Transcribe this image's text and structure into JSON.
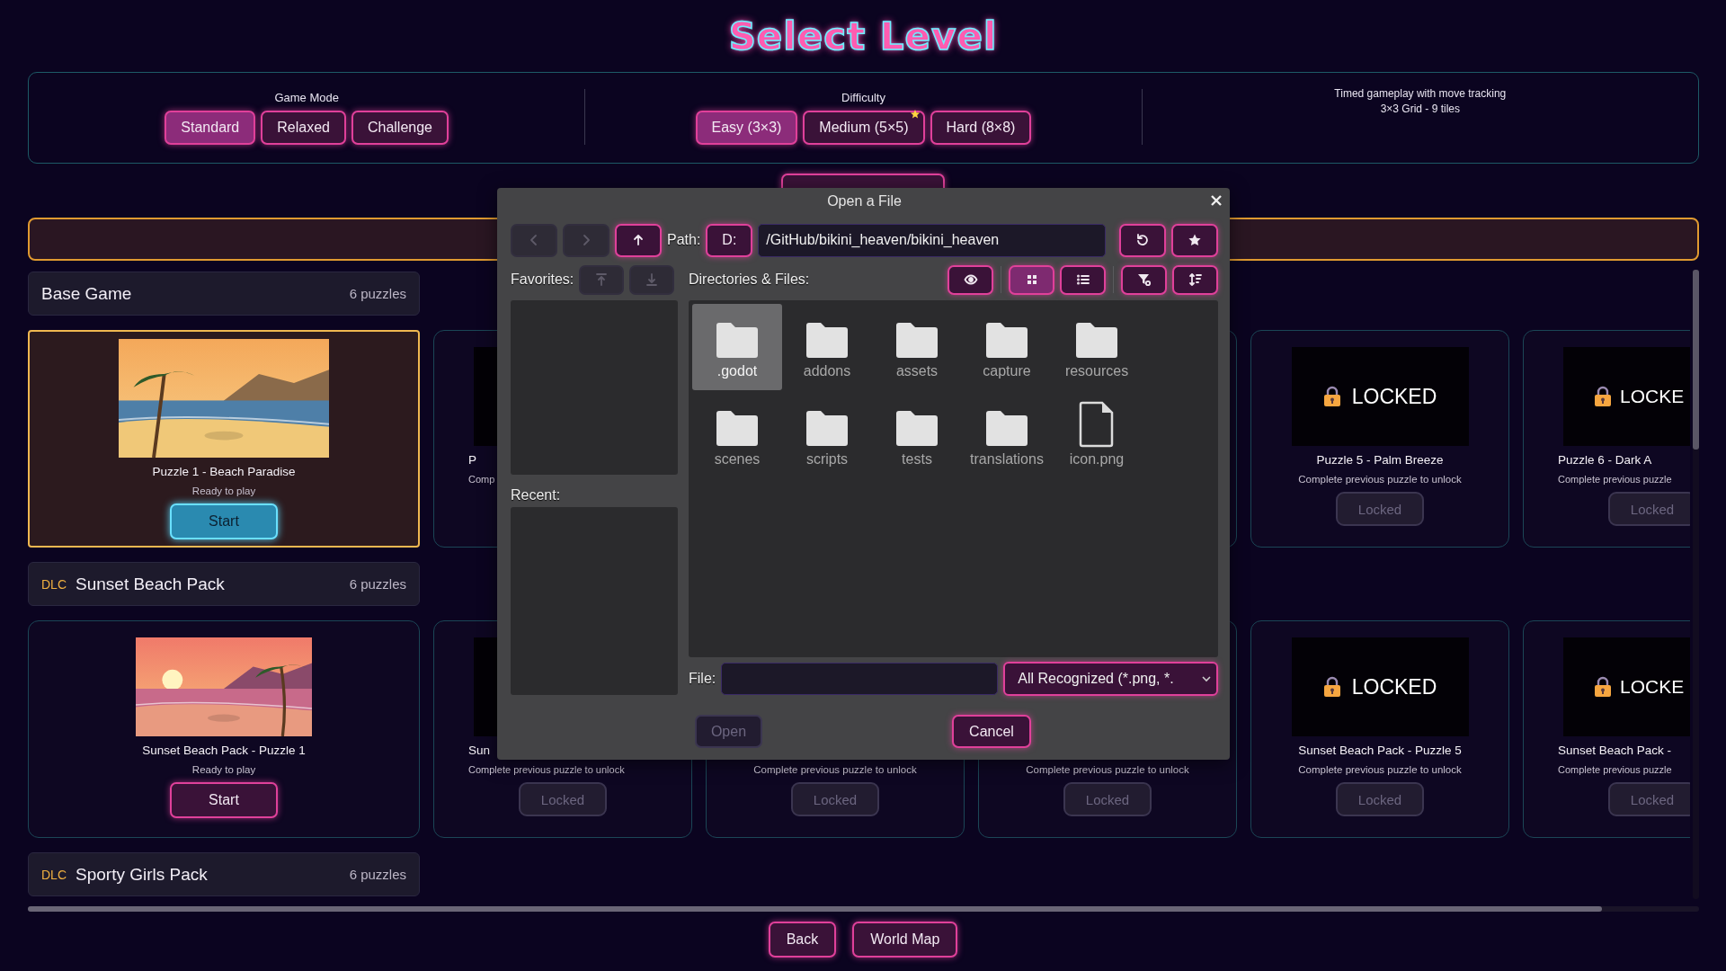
{
  "title": "Select Level",
  "game_mode": {
    "label": "Game Mode",
    "options": [
      {
        "label": "Standard",
        "selected": true
      },
      {
        "label": "Relaxed",
        "selected": false
      },
      {
        "label": "Challenge",
        "selected": false
      }
    ]
  },
  "difficulty": {
    "label": "Difficulty",
    "options": [
      {
        "label": "Easy (3×3)",
        "selected": true,
        "starred": false
      },
      {
        "label": "Medium (5×5)",
        "selected": false,
        "starred": true
      },
      {
        "label": "Hard (8×8)",
        "selected": false,
        "starred": false
      }
    ]
  },
  "mode_info": [
    "Timed gameplay with move tracking",
    "3×3 Grid - 9 tiles"
  ],
  "sections": [
    {
      "name": "Base Game",
      "count": "6 puzzles",
      "cards": [
        {
          "kind": "open",
          "title": "Puzzle 1 - Beach Paradise",
          "status": "Ready to play",
          "button": "Start",
          "selected": true
        },
        {
          "kind": "partial",
          "title": "P",
          "status": "Comp"
        },
        {
          "kind": "covered"
        },
        {
          "kind": "edge"
        },
        {
          "kind": "locked",
          "overlay": "LOCKED",
          "title": "Puzzle 5 - Palm Breeze",
          "status": "Complete previous puzzle to unlock",
          "button": "Locked"
        },
        {
          "kind": "partial",
          "overlay": "LOCKE",
          "title": "Puzzle 6 - Dark A",
          "status": "Complete previous puzzle",
          "button": "Locked"
        }
      ]
    },
    {
      "badge": "DLC",
      "name": "Sunset Beach Pack",
      "count": "6 puzzles",
      "cards": [
        {
          "kind": "open",
          "title": "Sunset Beach Pack - Puzzle 1",
          "status": "Ready to play",
          "button": "Start",
          "selected": false
        },
        {
          "kind": "partial",
          "title": "Sun",
          "status": "Complete previous puzzle to unlock",
          "button": "Locked"
        },
        {
          "kind": "locked",
          "status": "Complete previous puzzle to unlock",
          "button": "Locked"
        },
        {
          "kind": "locked",
          "status": "Complete previous puzzle to unlock",
          "button": "Locked"
        },
        {
          "kind": "locked",
          "overlay": "LOCKED",
          "title": "Sunset Beach Pack - Puzzle 5",
          "status": "Complete previous puzzle to unlock",
          "button": "Locked"
        },
        {
          "kind": "partial",
          "overlay": "LOCKE",
          "title": "Sunset Beach Pack -",
          "status": "Complete previous puzzle",
          "button": "Locked"
        }
      ]
    },
    {
      "badge": "DLC",
      "name": "Sporty Girls Pack",
      "count": "6 puzzles"
    }
  ],
  "dialog": {
    "title": "Open a File",
    "nav": [
      {
        "kind": "back",
        "disabled": true
      },
      {
        "kind": "forward",
        "disabled": true
      },
      {
        "kind": "up",
        "disabled": false
      }
    ],
    "path_label": "Path:",
    "drive": "D:",
    "path": "/GitHub/bikini_heaven/bikini_heaven",
    "path_actions": [
      {
        "kind": "refresh"
      },
      {
        "kind": "favorite"
      }
    ],
    "favorites_label": "Favorites:",
    "favorite_moves": [
      {
        "kind": "move-up",
        "disabled": true
      },
      {
        "kind": "move-down",
        "disabled": true
      }
    ],
    "files_label": "Directories & Files:",
    "view_tools": [
      {
        "kind": "show-hidden",
        "selected": false
      },
      {
        "kind": "grid",
        "selected": true
      },
      {
        "kind": "list",
        "selected": false
      }
    ],
    "sort_tools": [
      {
        "kind": "filter"
      },
      {
        "kind": "sort"
      }
    ],
    "recent_label": "Recent:",
    "files": [
      {
        "name": ".godot",
        "kind": "folder",
        "selected": true
      },
      {
        "name": "addons",
        "kind": "folder",
        "selected": false
      },
      {
        "name": "assets",
        "kind": "folder",
        "selected": false
      },
      {
        "name": "capture",
        "kind": "folder",
        "selected": false
      },
      {
        "name": "resources",
        "kind": "folder",
        "selected": false
      },
      {
        "name": "scenes",
        "kind": "folder",
        "selected": false
      },
      {
        "name": "scripts",
        "kind": "folder",
        "selected": false
      },
      {
        "name": "tests",
        "kind": "folder",
        "selected": false
      },
      {
        "name": "translations",
        "kind": "folder",
        "selected": false
      },
      {
        "name": "icon.png",
        "kind": "file",
        "selected": false
      }
    ],
    "file_label": "File:",
    "file_filter": "All Recognized (*.png, *.",
    "buttons": [
      {
        "label": "Open",
        "disabled": true
      },
      {
        "label": "Cancel",
        "disabled": false
      }
    ]
  },
  "footer": [
    "Back",
    "World Map"
  ]
}
